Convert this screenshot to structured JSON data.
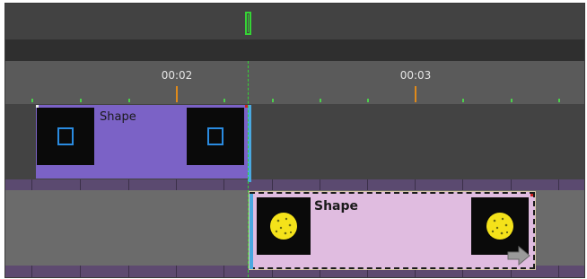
{
  "overview": {
    "playhead_marker_icon": "scrub-marker-icon",
    "accent_color": "#35d435"
  },
  "ruler": {
    "labels": [
      "00:02",
      "00:03"
    ],
    "major_tick_color": "#e08a1a",
    "minor_tick_color": "#4cd04c"
  },
  "tracks": [
    {
      "clip": {
        "label": "Shape",
        "start_icon": "square-outline-icon",
        "end_icon": "square-outline-icon",
        "color": "#7b62c6",
        "selected": false
      }
    },
    {
      "clip": {
        "label": "Shape",
        "start_icon": "yellow-dotted-circle-icon",
        "end_icon": "yellow-dotted-circle-icon",
        "color": "#e0bce0",
        "selected": true,
        "handle_icon": "move-arrow-icon"
      }
    }
  ]
}
